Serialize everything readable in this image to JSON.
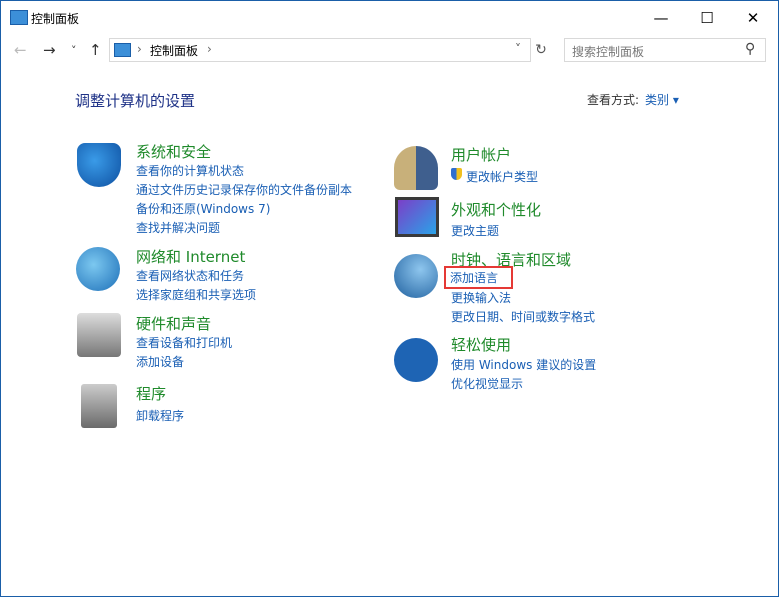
{
  "window": {
    "title": "控制面板",
    "minimize": "—",
    "maximize": "☐",
    "close": "✕"
  },
  "nav": {
    "back": "←",
    "forward": "→",
    "recent": "˅",
    "up": "↑",
    "refresh": "↻",
    "dropdown": "˅"
  },
  "address": {
    "sep1": "›",
    "crumb": "控制面板",
    "sep2": "›"
  },
  "search": {
    "placeholder": "搜索控制面板",
    "icon": "⚲"
  },
  "page": {
    "heading": "调整计算机的设置",
    "view_label": "查看方式:",
    "view_value": "类别 ▾"
  },
  "left": [
    {
      "title": "系统和安全",
      "links": [
        "查看你的计算机状态",
        "通过文件历史记录保存你的文件备份副本",
        "备份和还原(Windows 7)",
        "查找并解决问题"
      ]
    },
    {
      "title": "网络和 Internet",
      "links": [
        "查看网络状态和任务",
        "选择家庭组和共享选项"
      ]
    },
    {
      "title": "硬件和声音",
      "links": [
        "查看设备和打印机",
        "添加设备"
      ]
    },
    {
      "title": "程序",
      "links": [
        "卸载程序"
      ]
    }
  ],
  "right": [
    {
      "title": "用户帐户",
      "links": [
        "更改帐户类型"
      ]
    },
    {
      "title": "外观和个性化",
      "links": [
        "更改主题"
      ]
    },
    {
      "title": "时钟、语言和区域",
      "links": [
        "添加语言",
        "更换输入法",
        "更改日期、时间或数字格式"
      ]
    },
    {
      "title": "轻松使用",
      "links": [
        "使用 Windows 建议的设置",
        "优化视觉显示"
      ]
    }
  ],
  "colors": {
    "category": "#1f8a2b",
    "link": "#1a5fb4",
    "highlight": "#e53935"
  }
}
